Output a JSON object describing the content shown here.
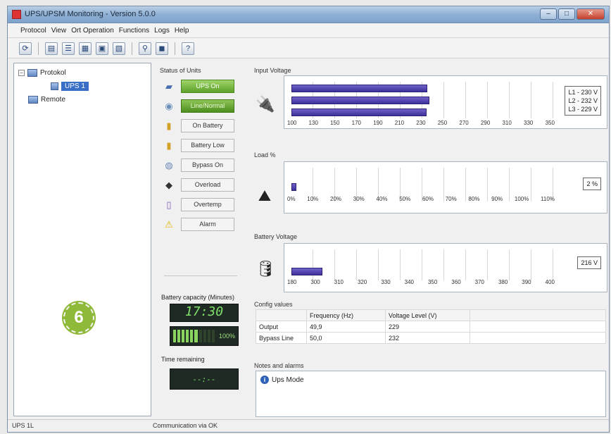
{
  "window": {
    "title": "UPS/UPSM Monitoring - Version 5.0.0",
    "controls": [
      "–",
      "□",
      "✕"
    ]
  },
  "menu": [
    "Protocol",
    "View",
    "Ort Operation",
    "Functions",
    "Logs",
    "Help"
  ],
  "toolbar": {
    "buttons": [
      "refresh-icon",
      "view-icon",
      "list-icon",
      "details-icon",
      "settings-icon",
      "config-icon",
      "filter-icon",
      "ups-icon",
      "help-icon"
    ]
  },
  "tree": {
    "root": "Protokol",
    "selected": "UPS 1",
    "remote": "Remote"
  },
  "badge": "6",
  "status": {
    "title": "Status of Units",
    "items": [
      {
        "label": "UPS On",
        "state": "on"
      },
      {
        "label": "Line/Normal",
        "state": "on2"
      },
      {
        "label": "On Battery",
        "state": "off"
      },
      {
        "label": "Battery Low",
        "state": "off"
      },
      {
        "label": "Bypass On",
        "state": "off"
      },
      {
        "label": "Overload",
        "state": "off"
      },
      {
        "label": "Overtemp",
        "state": "off"
      },
      {
        "label": "Alarm",
        "state": "off"
      }
    ],
    "icons": [
      "ups-unit-icon",
      "line-plug-icon",
      "battery-icon",
      "battery-low-icon",
      "bypass-icon",
      "overload-weight-icon",
      "temperature-icon",
      "warning-icon"
    ]
  },
  "battery_capacity": {
    "label": "Battery capacity (Minutes)",
    "time": "17:30",
    "percent": "100%",
    "fill_fraction": 0.62
  },
  "time_remaining": {
    "label": "Time remaining",
    "value": "--:--"
  },
  "input_voltage": {
    "title": "Input Voltage",
    "ticks": [
      "100",
      "130",
      "150",
      "170",
      "190",
      "210",
      "230",
      "250",
      "270",
      "290",
      "310",
      "330",
      "350"
    ],
    "min": 100,
    "max": 350,
    "phases": [
      {
        "label": "L1 - 230 V",
        "value": 230
      },
      {
        "label": "L2 - 232 V",
        "value": 232
      },
      {
        "label": "L3 - 229 V",
        "value": 229
      }
    ]
  },
  "load": {
    "title": "Load %",
    "ticks": [
      "0%",
      "10%",
      "20%",
      "30%",
      "40%",
      "50%",
      "60%",
      "70%",
      "80%",
      "90%",
      "100%",
      "110%"
    ],
    "min": 0,
    "max": 110,
    "value": 2,
    "readout": "2 %"
  },
  "battery_voltage": {
    "title": "Battery Voltage",
    "ticks": [
      "180",
      "300",
      "310",
      "320",
      "330",
      "340",
      "350",
      "360",
      "370",
      "380",
      "390",
      "400"
    ],
    "min": 0,
    "max": 11,
    "value": 1.3,
    "readout": "216 V"
  },
  "cfg_table": {
    "title": "Config values",
    "headers": [
      "",
      "Frequency (Hz)",
      "Voltage Level (V)",
      ""
    ],
    "rows": [
      [
        "Output",
        "49,9",
        "229",
        ""
      ],
      [
        "Bypass Line",
        "50,0",
        "232",
        ""
      ]
    ]
  },
  "notices": {
    "title": "Notes and alarms",
    "items": [
      "Ups Mode"
    ]
  },
  "statusbar": {
    "left": "UPS 1L",
    "middle": "Communication via OK"
  }
}
